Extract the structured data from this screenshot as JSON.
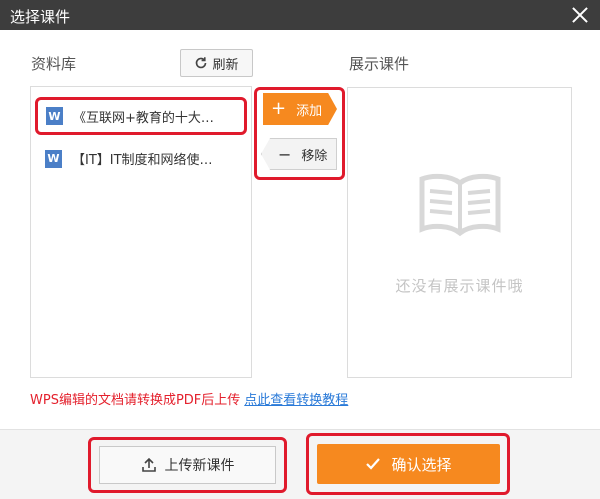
{
  "window": {
    "title": "选择课件"
  },
  "library": {
    "label": "资料库",
    "refresh_label": "刷新",
    "items": [
      {
        "icon_letter": "W",
        "title": "《互联网+教育的十大…"
      },
      {
        "icon_letter": "W",
        "title": "【IT】IT制度和网络使…"
      }
    ]
  },
  "actions": {
    "add_label": "添加",
    "remove_label": "移除"
  },
  "display": {
    "label": "展示课件",
    "empty_text": "还没有展示课件哦"
  },
  "notice": {
    "text": "WPS编辑的文档请转换成PDF后上传",
    "link_text": "点此查看转换教程"
  },
  "footer": {
    "upload_label": "上传新课件",
    "confirm_label": "确认选择"
  },
  "colors": {
    "accent": "#f6891f",
    "highlight_border": "#e01a2c",
    "word_icon": "#4b7fc7",
    "warning_text": "#e4212d",
    "link": "#2a7ad8"
  }
}
